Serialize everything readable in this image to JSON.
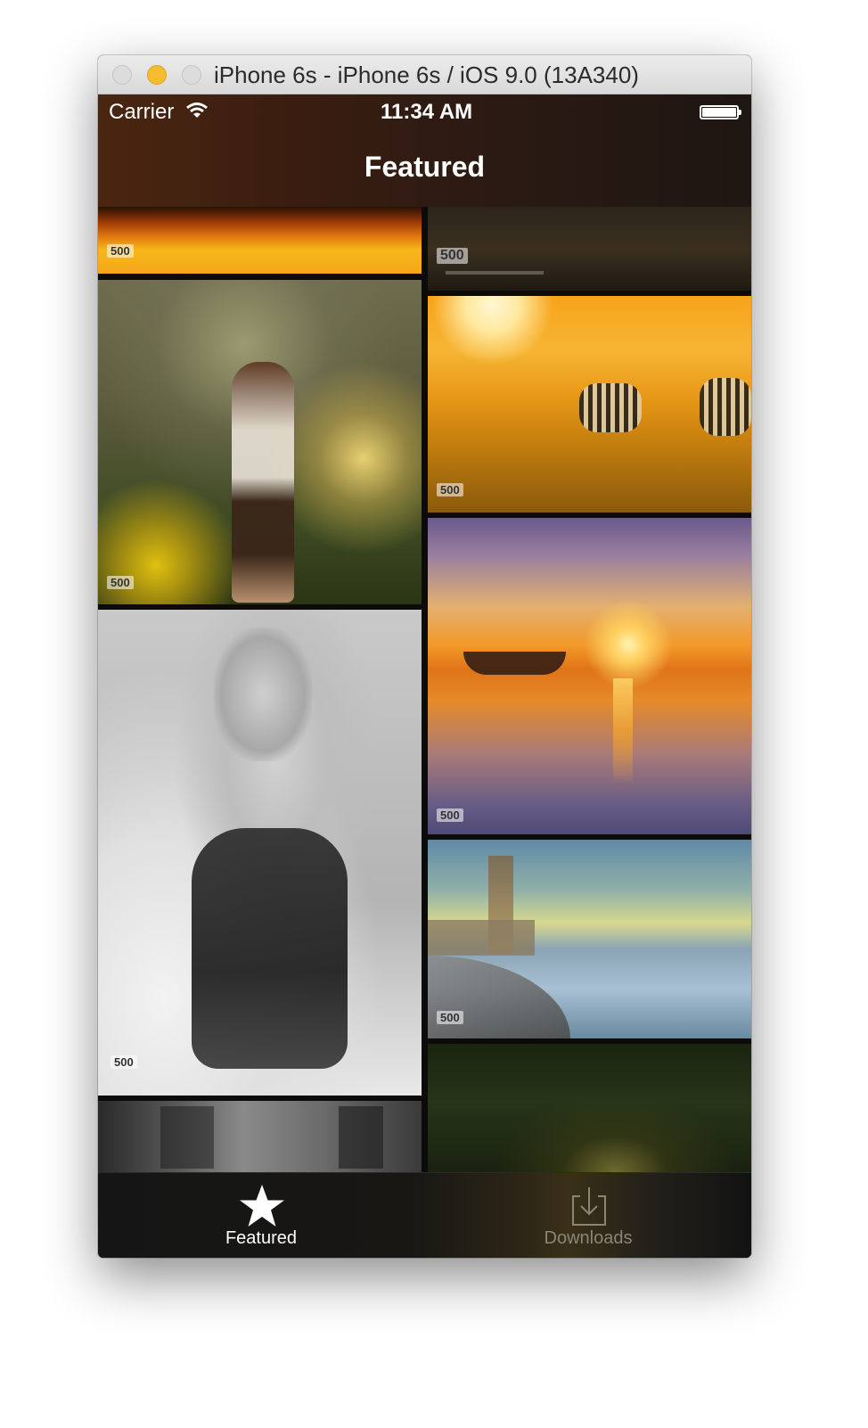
{
  "window": {
    "title": "iPhone 6s - iPhone 6s / iOS 9.0 (13A340)"
  },
  "status_bar": {
    "carrier": "Carrier",
    "time": "11:34 AM"
  },
  "nav": {
    "title": "Featured"
  },
  "photos": {
    "watermark": "500"
  },
  "tabs": [
    {
      "label": "Featured",
      "icon": "star-icon",
      "active": true
    },
    {
      "label": "Downloads",
      "icon": "download-icon",
      "active": false
    }
  ],
  "colors": {
    "tab_active": "#ffffff",
    "tab_inactive": "#8a8577",
    "navbar": "#3a1d10"
  }
}
